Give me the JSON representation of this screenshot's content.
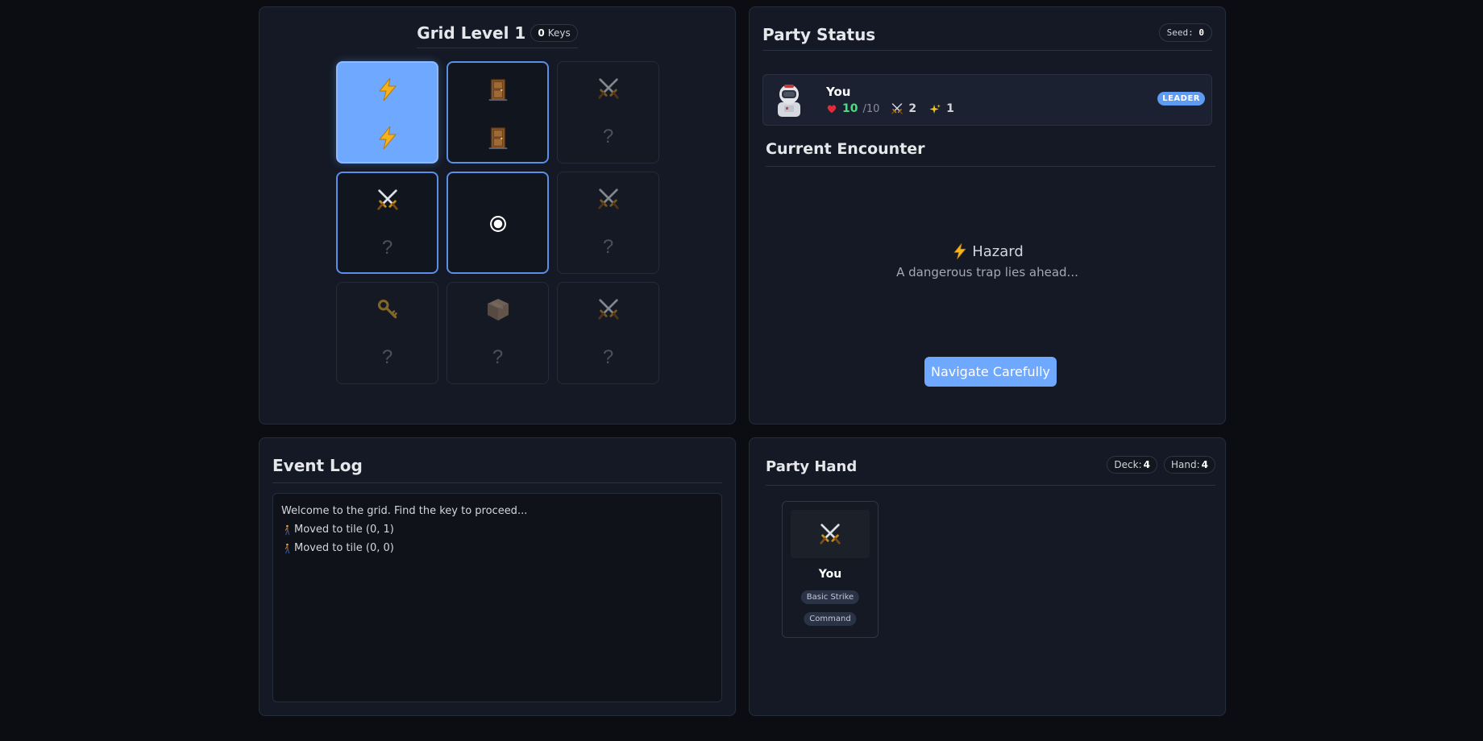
{
  "grid": {
    "title": "Grid Level 1",
    "keys_count": "0",
    "keys_label": "Keys",
    "unknown_mark": "?",
    "tiles": [
      {
        "row": 0,
        "col": 0,
        "top_icon": "lightning-icon",
        "bottom_icon": "lightning-icon",
        "state": "current"
      },
      {
        "row": 0,
        "col": 1,
        "top_icon": "door-icon",
        "bottom_icon": "door-icon",
        "state": "adjacent"
      },
      {
        "row": 0,
        "col": 2,
        "top_icon": "crossed-swords-icon",
        "bottom": "?",
        "state": "unrevealed"
      },
      {
        "row": 1,
        "col": 0,
        "top_icon": "crossed-swords-icon",
        "bottom": "?",
        "state": "adjacent"
      },
      {
        "row": 1,
        "col": 1,
        "center_icon": "radio-marker-icon",
        "state": "adjacent"
      },
      {
        "row": 1,
        "col": 2,
        "top_icon": "crossed-swords-icon",
        "bottom": "?",
        "state": "unrevealed"
      },
      {
        "row": 2,
        "col": 0,
        "top_icon": "key-icon",
        "bottom": "?",
        "state": "unrevealed"
      },
      {
        "row": 2,
        "col": 1,
        "top_icon": "box-icon",
        "bottom": "?",
        "state": "unrevealed"
      },
      {
        "row": 2,
        "col": 2,
        "top_icon": "crossed-swords-icon",
        "bottom": "?",
        "state": "unrevealed"
      }
    ]
  },
  "party": {
    "title": "Party Status",
    "seed_label": "Seed:",
    "seed_value": "0",
    "member": {
      "name": "You",
      "hp": "10",
      "hp_max": "/10",
      "attack": "2",
      "magic": "1",
      "badge": "LEADER",
      "avatar_icon": "astronaut-icon"
    }
  },
  "encounter": {
    "title": "Current Encounter",
    "name": "Hazard",
    "icon": "lightning-icon",
    "description": "A dangerous trap lies ahead...",
    "action_label": "Navigate Carefully"
  },
  "log": {
    "title": "Event Log",
    "entries": [
      {
        "icon": "",
        "text": "Welcome to the grid. Find the key to proceed..."
      },
      {
        "icon": "walking-person-icon",
        "text": "Moved to tile (0, 1)"
      },
      {
        "icon": "walking-person-icon",
        "text": "Moved to tile (0, 0)"
      }
    ]
  },
  "hand": {
    "title": "Party Hand",
    "deck_label": "Deck:",
    "deck_count": "4",
    "hand_label": "Hand:",
    "hand_count": "4",
    "cards": [
      {
        "owner": "You",
        "icon": "crossed-swords-icon",
        "tags": [
          "Basic Strike",
          "Command"
        ]
      }
    ]
  },
  "colors": {
    "accent": "#6ea8ff",
    "hp_green": "#4ade80",
    "background": "#0c0d12",
    "panel": "#141925"
  }
}
